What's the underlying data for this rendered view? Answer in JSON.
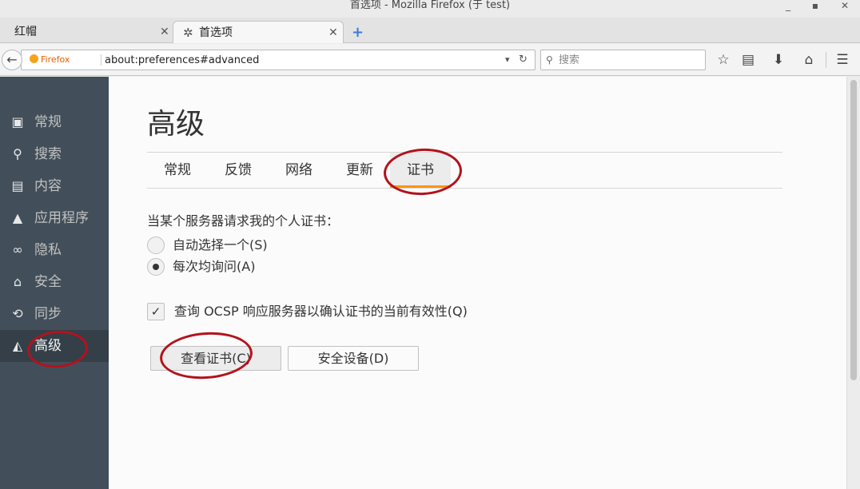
{
  "window": {
    "title": "首选项 - Mozilla Firefox (于 test)",
    "controls": {
      "minimize": "_",
      "maximize": "▪",
      "close": "✕"
    }
  },
  "tabs": {
    "items": [
      {
        "label": "红帽"
      },
      {
        "label": "首选项"
      }
    ],
    "close_glyph": "✕",
    "new_tab_glyph": "+"
  },
  "navbar": {
    "identity_label": "Firefox",
    "url": "about:preferences#advanced",
    "search_placeholder": "搜索",
    "icons": [
      "back-icon",
      "bookmark-star-icon",
      "reading-list-icon",
      "download-icon",
      "home-icon",
      "menu-icon"
    ]
  },
  "sidebar": {
    "items": [
      {
        "label": "常规",
        "icon": "general-icon"
      },
      {
        "label": "搜索",
        "icon": "search-icon"
      },
      {
        "label": "内容",
        "icon": "content-icon"
      },
      {
        "label": "应用程序",
        "icon": "applications-icon"
      },
      {
        "label": "隐私",
        "icon": "privacy-mask-icon"
      },
      {
        "label": "安全",
        "icon": "security-icon"
      },
      {
        "label": "同步",
        "icon": "sync-icon"
      },
      {
        "label": "高级",
        "icon": "advanced-icon"
      }
    ],
    "selected": "高级"
  },
  "main": {
    "heading": "高级",
    "subtabs": [
      "常规",
      "反馈",
      "网络",
      "更新",
      "证书"
    ],
    "selected_subtab": "证书",
    "accent_color": "#ff9500",
    "certificate_request": {
      "label": "当某个服务器请求我的个人证书：",
      "options": [
        {
          "label": "自动选择一个(S)",
          "checked": false
        },
        {
          "label": "每次均询问(A)",
          "checked": true
        }
      ]
    },
    "ocsp": {
      "label": "查询 OCSP 响应服务器以确认证书的当前有效性(Q)",
      "checked": true
    },
    "buttons": {
      "view_certificates": "查看证书(C)",
      "security_devices": "安全设备(D)"
    }
  },
  "annotation_color": "#b3121c"
}
